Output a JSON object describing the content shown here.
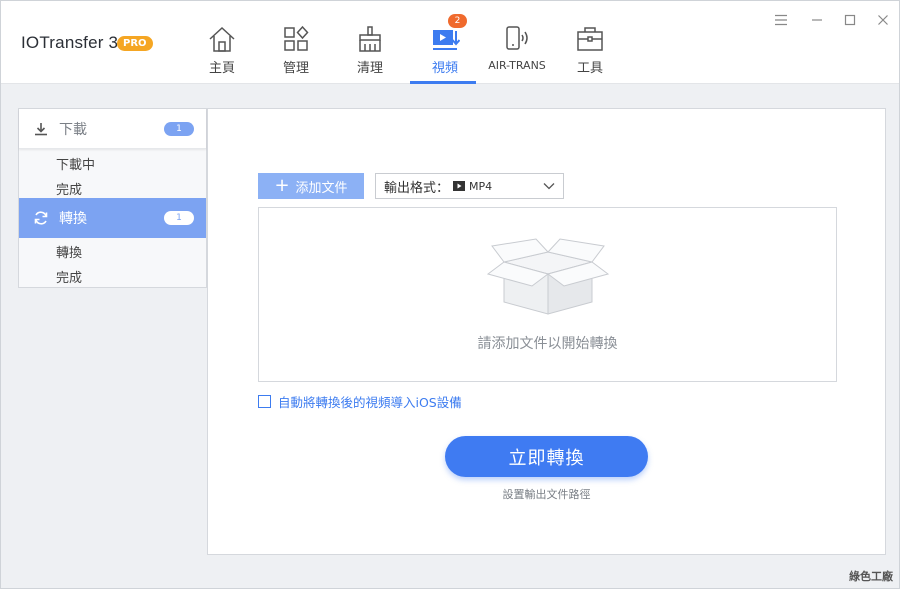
{
  "header": {
    "app_title": "IOTransfer 3",
    "pro_badge": "PRO",
    "tabs": [
      {
        "label": "主頁",
        "icon": "home-icon"
      },
      {
        "label": "管理",
        "icon": "grid-manage-icon"
      },
      {
        "label": "清理",
        "icon": "broom-clean-icon"
      },
      {
        "label": "視頻",
        "icon": "video-download-icon",
        "badge": "2",
        "active": true
      },
      {
        "label": "AIR-TRANS",
        "icon": "phone-wireless-icon"
      },
      {
        "label": "工具",
        "icon": "toolbox-icon"
      }
    ],
    "window_controls": [
      "menu-icon",
      "minimize-icon",
      "maximize-icon",
      "close-icon"
    ]
  },
  "sidebar": {
    "download": {
      "label": "下載",
      "count": "1",
      "icon": "download-icon",
      "items": [
        "下載中",
        "完成"
      ]
    },
    "convert": {
      "label": "轉換",
      "count": "1",
      "icon": "refresh-icon",
      "items": [
        "轉換",
        "完成"
      ],
      "active": true
    }
  },
  "main": {
    "add_button": "添加文件",
    "format_label": "輸出格式：",
    "format_value": "MP4",
    "drop_hint": "請添加文件以開始轉換",
    "import_option": "自動將轉換後的視頻導入iOS設備",
    "import_checked": false,
    "convert_button": "立即轉換",
    "path_link": "設置輸出文件路徑"
  },
  "watermark": "綠色工廠",
  "colors": {
    "accent": "#3d7cf0",
    "sidebar_active": "#7ca3f2",
    "badge": "#f06a2d",
    "pro": "#f5a623"
  }
}
